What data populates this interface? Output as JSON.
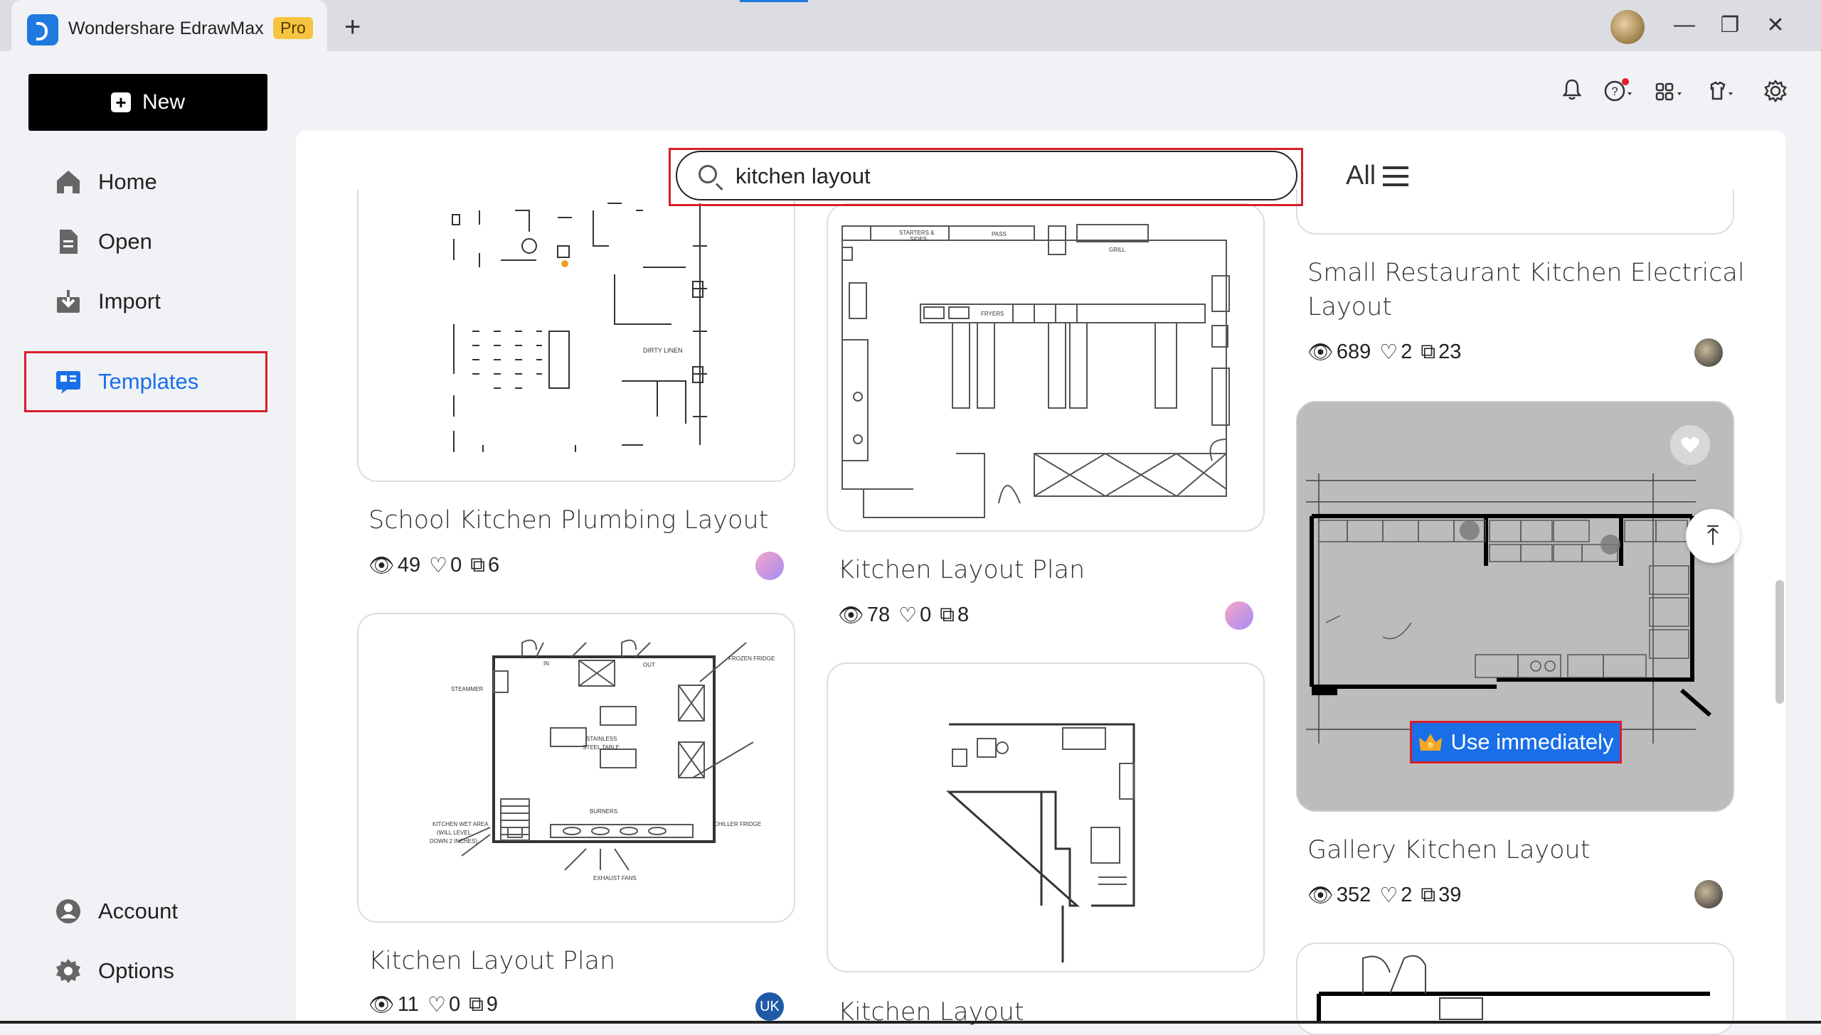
{
  "titlebar": {
    "app_name": "Wondershare EdrawMax",
    "badge": "Pro",
    "new_tab": "+",
    "minimize": "—",
    "restore": "❐",
    "close": "✕"
  },
  "toolbar": {
    "icons": [
      "bell-icon",
      "help-icon",
      "apps-icon",
      "theme-icon",
      "settings-icon"
    ]
  },
  "sidebar": {
    "new_label": "New",
    "items": [
      {
        "label": "Home",
        "icon": "home-icon"
      },
      {
        "label": "Open",
        "icon": "file-icon"
      },
      {
        "label": "Import",
        "icon": "import-icon"
      },
      {
        "label": "Templates",
        "icon": "templates-icon",
        "active": true
      }
    ],
    "bottom_items": [
      {
        "label": "Account",
        "icon": "account-icon"
      },
      {
        "label": "Options",
        "icon": "gear-icon"
      }
    ]
  },
  "search": {
    "value": "kitchen layout",
    "filter_label": "All"
  },
  "cards": [
    {
      "title": "School Kitchen Plumbing Layout",
      "views": "49",
      "likes": "0",
      "copies": "6"
    },
    {
      "title": "Kitchen Layout Plan",
      "views": "11",
      "likes": "0",
      "copies": "9",
      "author_initials": "UK"
    },
    {
      "title": "Kitchen Layout Plan",
      "views": "78",
      "likes": "0",
      "copies": "8"
    },
    {
      "title": "Kitchen Layout"
    },
    {
      "title_line1": "Small Restaurant Kitchen Electrical",
      "title_line2": "Layout",
      "views": "689",
      "likes": "2",
      "copies": "23"
    },
    {
      "title": "Gallery Kitchen Layout",
      "views": "352",
      "likes": "2",
      "copies": "39",
      "use_label": "Use immediately"
    }
  ],
  "diagram_text": {
    "plumbing": {
      "dirty_linen": "DIRTY LINEN"
    },
    "plan2": {
      "in": "IN",
      "out": "OUT",
      "frozen": "FROZEN FRIDGE",
      "steamer": "STEAMMER",
      "stainless": "STAINLESS",
      "steel_table": "STEEL TABLE",
      "burners": "BURNERS",
      "chiller": "CHILLER FRIDGE",
      "wet_area": "KITCHEN WET AREA",
      "will_level": "(WILL LEVEL",
      "down": "DOWN 2 INCHES)",
      "exhaust": "EXHAUST FANS"
    },
    "plan1": {
      "starters": "STARTERS &",
      "sides": "SIDES",
      "pass": "PASS",
      "grill": "GRILL",
      "fryers": "FRYERS"
    }
  },
  "colors": {
    "accent": "#1a6fe8",
    "highlight": "#d81e2b",
    "pro": "#f6c440"
  }
}
